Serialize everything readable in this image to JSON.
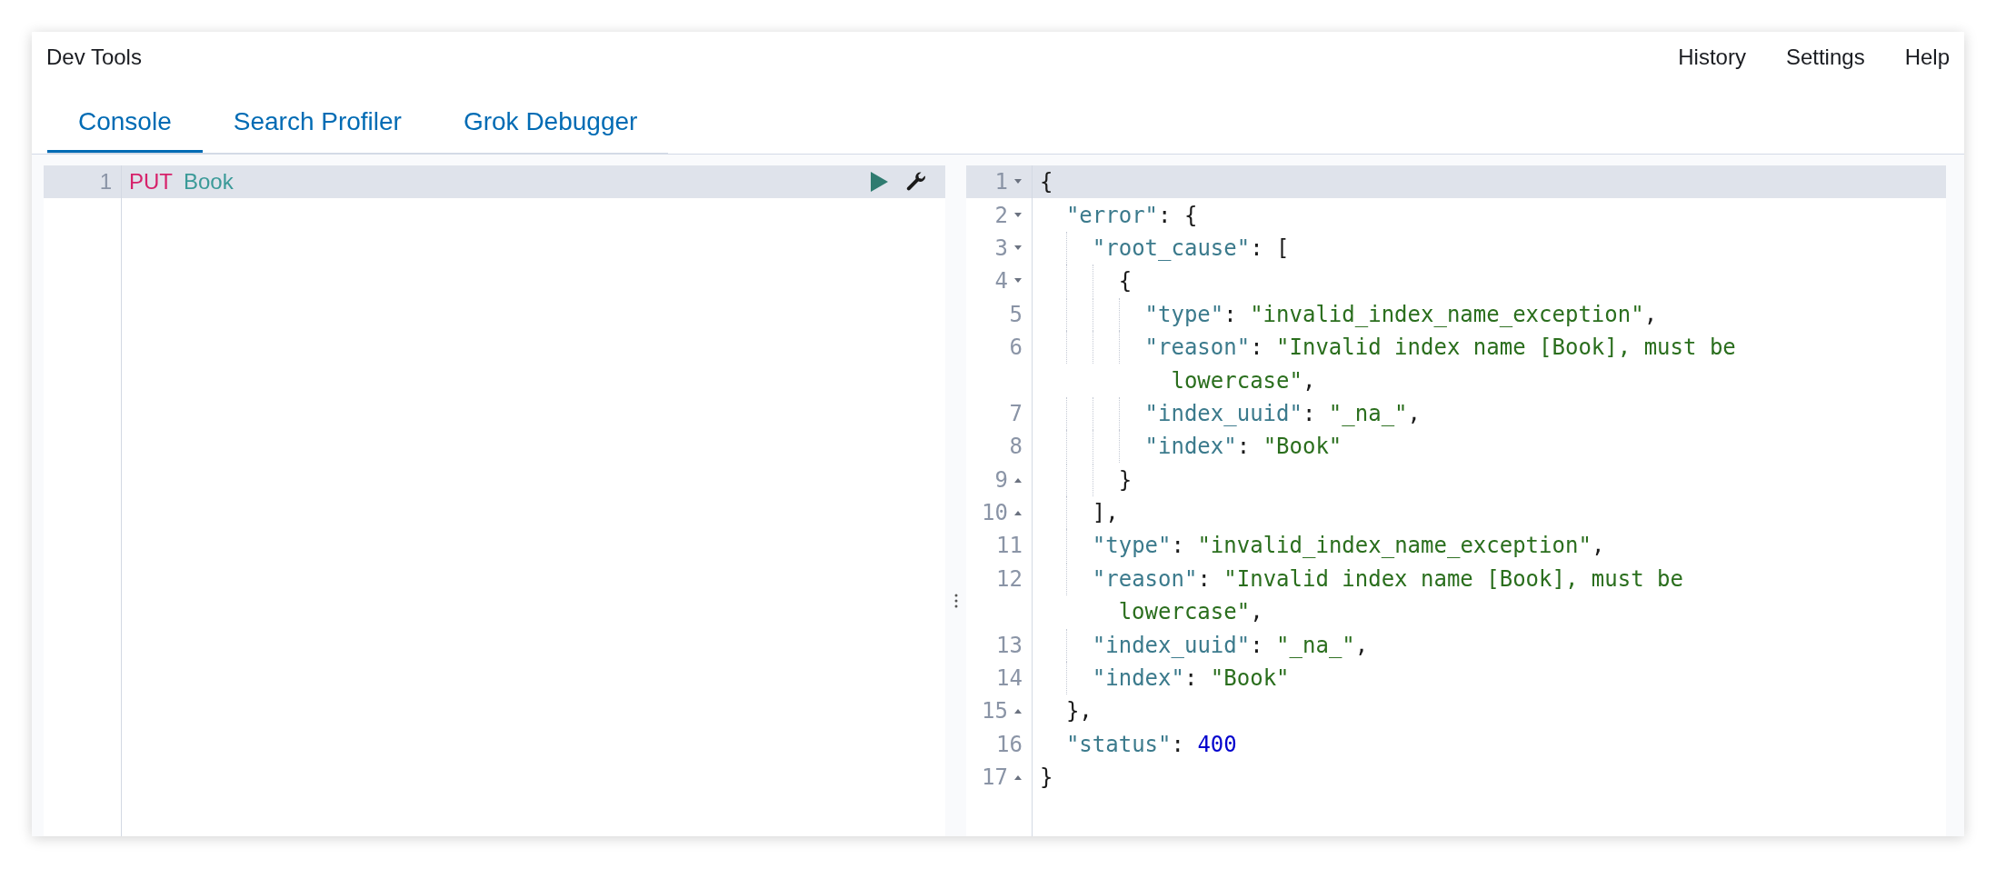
{
  "app_title": "Dev Tools",
  "header_links": [
    "History",
    "Settings",
    "Help"
  ],
  "tabs": [
    {
      "label": "Console",
      "selected": true
    },
    {
      "label": "Search Profiler",
      "selected": false
    },
    {
      "label": "Grok Debugger",
      "selected": false
    }
  ],
  "request": {
    "lines": [
      {
        "number": "1",
        "active": true,
        "tokens": [
          {
            "kind": "method",
            "text": "PUT"
          },
          {
            "kind": "url",
            "text": "Book"
          }
        ]
      }
    ]
  },
  "response": {
    "lines": [
      {
        "number": "1",
        "active": true,
        "kind": "block_start",
        "tokens": [
          {
            "kind": "punct",
            "text": "{"
          }
        ]
      },
      {
        "number": "2",
        "active": false,
        "kind": "block_start",
        "tokens": [
          {
            "kind": "key",
            "text": "  \"error\""
          },
          {
            "kind": "punct",
            "text": ": {"
          }
        ]
      },
      {
        "number": "3",
        "active": false,
        "kind": "block_start",
        "tokens": [
          {
            "kind": "key",
            "text": "    \"root_cause\""
          },
          {
            "kind": "punct",
            "text": ": ["
          }
        ]
      },
      {
        "number": "4",
        "active": false,
        "kind": "block_start",
        "tokens": [
          {
            "kind": "punct",
            "text": "      {"
          }
        ]
      },
      {
        "number": "5",
        "active": false,
        "tokens": [
          {
            "kind": "key",
            "text": "        \"type\""
          },
          {
            "kind": "punct",
            "text": ": "
          },
          {
            "kind": "string",
            "text": "\"invalid_index_name_exception\""
          },
          {
            "kind": "punct",
            "text": ","
          }
        ]
      },
      {
        "number": "6",
        "active": false,
        "tokens": [
          {
            "kind": "key",
            "text": "        \"reason\""
          },
          {
            "kind": "punct",
            "text": ": "
          },
          {
            "kind": "string",
            "text": "\"Invalid index name [Book], must be"
          }
        ],
        "wrap": [
          {
            "kind": "string",
            "text": "          lowercase\""
          },
          {
            "kind": "punct",
            "text": ","
          }
        ]
      },
      {
        "number": "7",
        "active": false,
        "tokens": [
          {
            "kind": "key",
            "text": "        \"index_uuid\""
          },
          {
            "kind": "punct",
            "text": ": "
          },
          {
            "kind": "string",
            "text": "\"_na_\""
          },
          {
            "kind": "punct",
            "text": ","
          }
        ]
      },
      {
        "number": "8",
        "active": false,
        "tokens": [
          {
            "kind": "key",
            "text": "        \"index\""
          },
          {
            "kind": "punct",
            "text": ": "
          },
          {
            "kind": "string",
            "text": "\"Book\""
          }
        ]
      },
      {
        "number": "9",
        "active": false,
        "kind": "block_end",
        "tokens": [
          {
            "kind": "punct",
            "text": "      }"
          }
        ]
      },
      {
        "number": "10",
        "active": false,
        "kind": "block_end",
        "tokens": [
          {
            "kind": "punct",
            "text": "    ],"
          }
        ]
      },
      {
        "number": "11",
        "active": false,
        "tokens": [
          {
            "kind": "key",
            "text": "    \"type\""
          },
          {
            "kind": "punct",
            "text": ": "
          },
          {
            "kind": "string",
            "text": "\"invalid_index_name_exception\""
          },
          {
            "kind": "punct",
            "text": ","
          }
        ]
      },
      {
        "number": "12",
        "active": false,
        "tokens": [
          {
            "kind": "key",
            "text": "    \"reason\""
          },
          {
            "kind": "punct",
            "text": ": "
          },
          {
            "kind": "string",
            "text": "\"Invalid index name [Book], must be"
          }
        ],
        "wrap": [
          {
            "kind": "string",
            "text": "      lowercase\""
          },
          {
            "kind": "punct",
            "text": ","
          }
        ]
      },
      {
        "number": "13",
        "active": false,
        "tokens": [
          {
            "kind": "key",
            "text": "    \"index_uuid\""
          },
          {
            "kind": "punct",
            "text": ": "
          },
          {
            "kind": "string",
            "text": "\"_na_\""
          },
          {
            "kind": "punct",
            "text": ","
          }
        ]
      },
      {
        "number": "14",
        "active": false,
        "tokens": [
          {
            "kind": "key",
            "text": "    \"index\""
          },
          {
            "kind": "punct",
            "text": ": "
          },
          {
            "kind": "string",
            "text": "\"Book\""
          }
        ]
      },
      {
        "number": "15",
        "active": false,
        "kind": "block_end",
        "tokens": [
          {
            "kind": "punct",
            "text": "  },"
          }
        ]
      },
      {
        "number": "16",
        "active": false,
        "tokens": [
          {
            "kind": "key",
            "text": "  \"status\""
          },
          {
            "kind": "punct",
            "text": ": "
          },
          {
            "kind": "number",
            "text": "400"
          }
        ]
      },
      {
        "number": "17",
        "active": false,
        "kind": "block_end",
        "tokens": [
          {
            "kind": "punct",
            "text": "}"
          }
        ]
      }
    ]
  }
}
